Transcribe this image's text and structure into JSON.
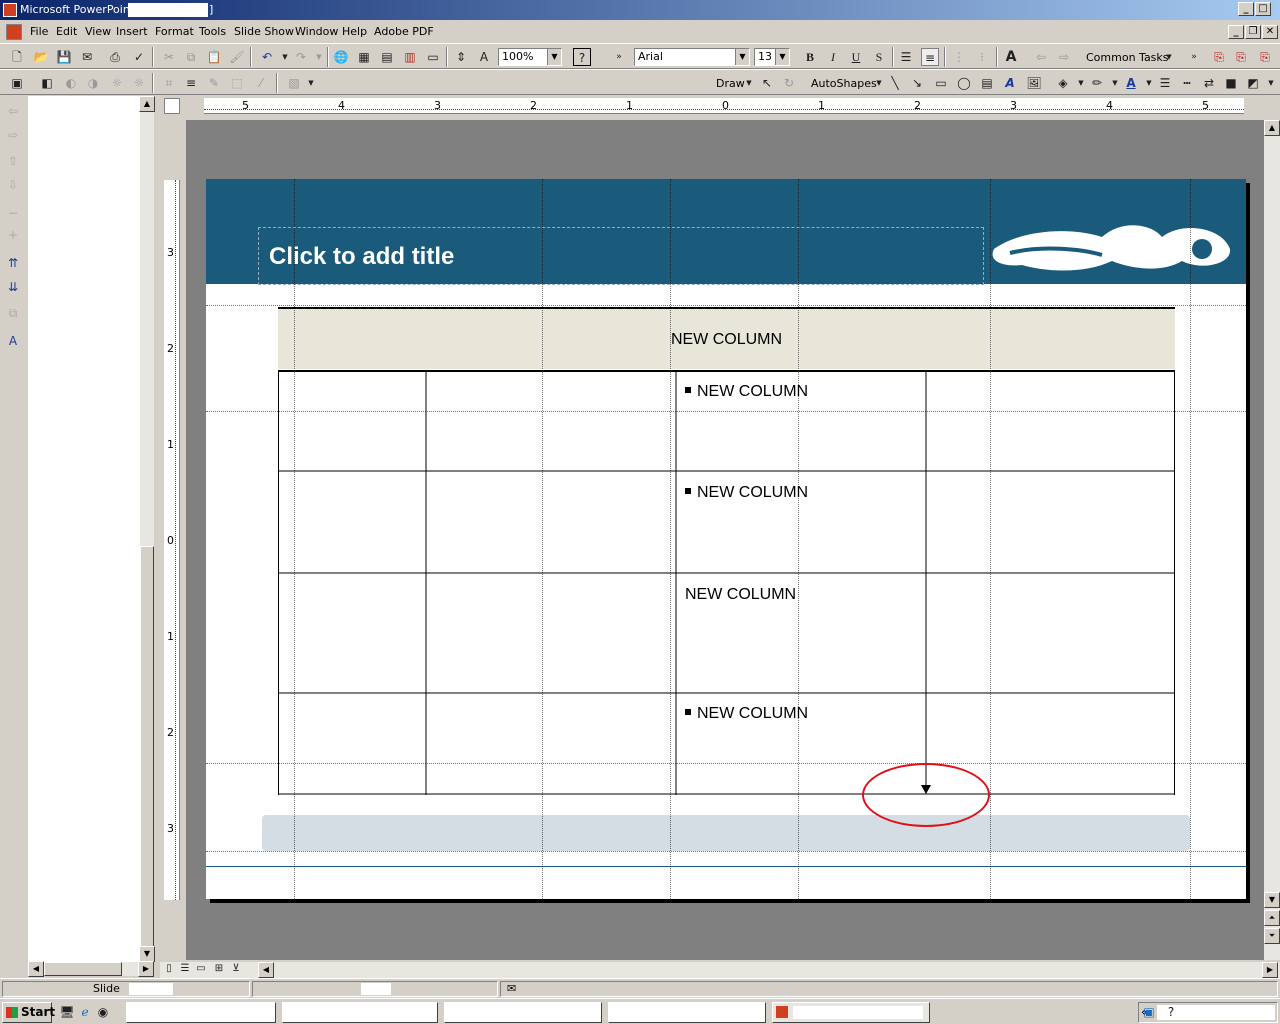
{
  "window": {
    "title": "Microsoft PowerPoint - [",
    "title_suffix": "]"
  },
  "menu": [
    {
      "label": "File"
    },
    {
      "label": "Edit"
    },
    {
      "label": "View"
    },
    {
      "label": "Insert"
    },
    {
      "label": "Format"
    },
    {
      "label": "Tools"
    },
    {
      "label": "Slide Show"
    },
    {
      "label": "Window"
    },
    {
      "label": "Help"
    },
    {
      "label": "Adobe PDF"
    }
  ],
  "toolbar": {
    "zoom_value": "100%",
    "font_name": "Arial",
    "font_size": "13",
    "bold_label": "B",
    "italic_label": "I",
    "underline_label": "U",
    "shadow_label": "S",
    "common_tasks_label": "Common Tasks",
    "draw_label": "Draw",
    "autoshapes_label": "AutoShapes"
  },
  "ruler": {
    "h_ticks": [
      "5",
      "4",
      "3",
      "2",
      "1",
      "0",
      "1",
      "2",
      "3",
      "4",
      "5"
    ],
    "v_ticks": [
      "3",
      "2",
      "1",
      "0",
      "1",
      "2",
      "3"
    ]
  },
  "slide": {
    "title_placeholder": "Click to add title",
    "table": {
      "header": "NEW COLUMN",
      "rows": [
        {
          "text": "NEW COLUMN",
          "bullet": true
        },
        {
          "text": "NEW COLUMN",
          "bullet": true
        },
        {
          "text": "NEW COLUMN",
          "bullet": false
        },
        {
          "text": "NEW COLUMN",
          "bullet": true
        }
      ]
    }
  },
  "status": {
    "slide_label": "Slide"
  },
  "taskbar": {
    "start_label": "Start",
    "tray_chevron": "«"
  },
  "colors": {
    "header_blue": "#1a5a7a",
    "table_header_fill": "#e8e6d8",
    "annotation_red": "#e0101a",
    "footer_band": "#d4dde4"
  }
}
